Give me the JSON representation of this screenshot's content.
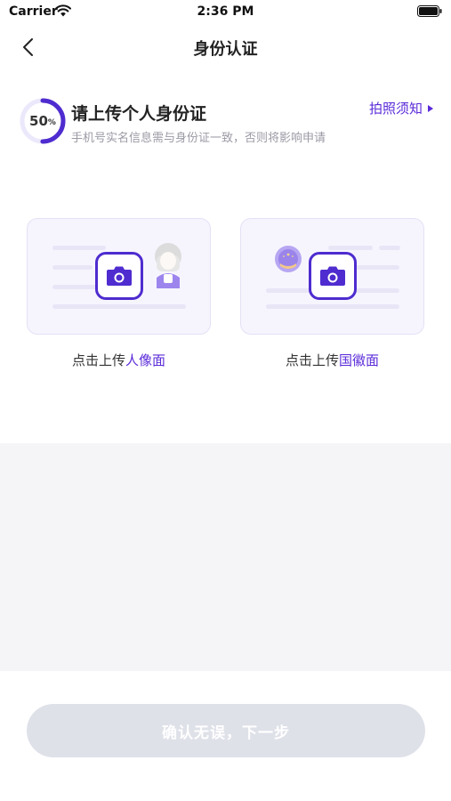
{
  "status_bar": {
    "carrier": "Carrier",
    "time": "2:36 PM",
    "icons": [
      "wifi-icon",
      "battery-icon"
    ]
  },
  "nav": {
    "title": "身份认证",
    "back_icon": "chevron-left-icon"
  },
  "progress": {
    "value": 50,
    "number": "50",
    "unit": "%",
    "heading": "请上传个人身份证",
    "subtext": "手机号实名信息需与身份证一致，否则将影响申请",
    "tips_label": "拍照须知"
  },
  "cards": {
    "front": {
      "label_prefix": "点击上传",
      "label_accent": "人像面"
    },
    "back": {
      "label_prefix": "点击上传",
      "label_accent": "国徽面"
    }
  },
  "confirm": {
    "label": "确认无误，下一步",
    "enabled": false
  },
  "colors": {
    "accent": "#5b2bd9",
    "camera_border": "#4e2ccf",
    "card_bg": "#f6f5fe",
    "button_disabled": "#dfe1e9",
    "band": "#f5f5f7"
  }
}
